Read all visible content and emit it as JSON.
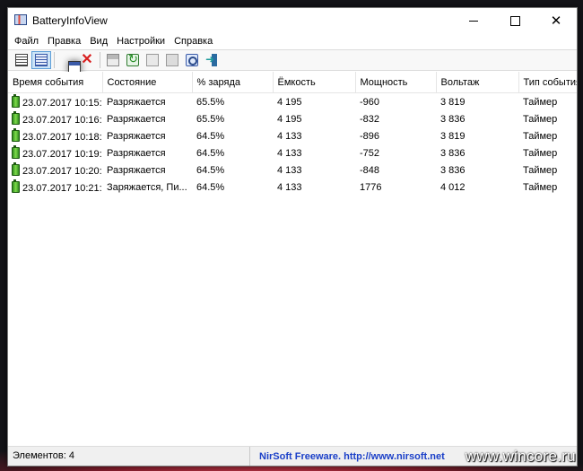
{
  "window": {
    "title": "BatteryInfoView"
  },
  "menu": [
    "Файл",
    "Правка",
    "Вид",
    "Настройки",
    "Справка"
  ],
  "toolbar": {
    "icons": [
      "list-view-icon",
      "details-view-icon",
      "window-icon",
      "delete-icon",
      "save-icon",
      "refresh-icon",
      "copy-icon",
      "properties-icon",
      "find-icon",
      "exit-icon"
    ]
  },
  "table": {
    "columns": [
      "Время события",
      "Состояние",
      "% заряда",
      "Ёмкость",
      "Мощность",
      "Вольтаж",
      "Тип события"
    ],
    "rows": [
      [
        "23.07.2017 10:15:...",
        "Разряжается",
        "65.5%",
        "4 195",
        "-960",
        "3 819",
        "Таймер"
      ],
      [
        "23.07.2017 10:16:...",
        "Разряжается",
        "65.5%",
        "4 195",
        "-832",
        "3 836",
        "Таймер"
      ],
      [
        "23.07.2017 10:18:...",
        "Разряжается",
        "64.5%",
        "4 133",
        "-896",
        "3 819",
        "Таймер"
      ],
      [
        "23.07.2017 10:19:...",
        "Разряжается",
        "64.5%",
        "4 133",
        "-752",
        "3 836",
        "Таймер"
      ],
      [
        "23.07.2017 10:20:...",
        "Разряжается",
        "64.5%",
        "4 133",
        "-848",
        "3 836",
        "Таймер"
      ],
      [
        "23.07.2017 10:21:...",
        "Заряжается, Пи...",
        "64.5%",
        "4 133",
        "1776",
        "4 012",
        "Таймер"
      ]
    ]
  },
  "status": {
    "count": "Элементов: 4",
    "link": "NirSoft Freeware.  http://www.nirsoft.net"
  },
  "watermark": "www.wincore.ru",
  "colors": {
    "link": "#1a3fc8",
    "active_button": "#cce4f7"
  }
}
